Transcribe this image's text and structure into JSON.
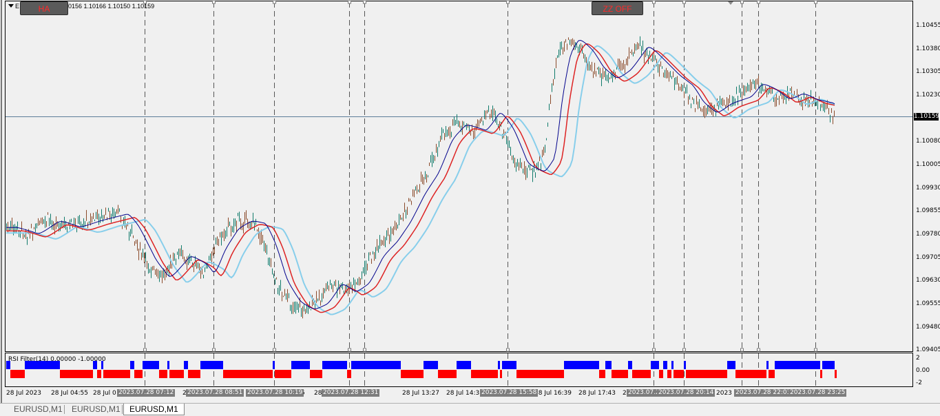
{
  "header": {
    "symbol_prefix": "E",
    "ohlc_partial": "0156 1.10166 1.10150 1.10159",
    "ha_button": "HA",
    "zz_button": "ZZ OFF"
  },
  "price_axis": {
    "labels": [
      "1.10455",
      "1.10380",
      "1.10305",
      "1.10230",
      "1.10080",
      "1.10005",
      "1.09930",
      "1.09855",
      "1.09780",
      "1.09705",
      "1.09630",
      "1.09555",
      "1.09480",
      "1.09405"
    ],
    "current_price": "1.10159"
  },
  "indicator": {
    "title": "RSI Filter(14) 0.00000 -1.00000",
    "levels": [
      "2",
      "0.00",
      "-2"
    ]
  },
  "time_axis": {
    "labels": [
      "28 Jul 2023",
      "28 Jul 04:55",
      "28 Jul 0",
      "2",
      "28",
      "5",
      "28 Jul 13:27",
      "28 Jul 14:31",
      "28 Jul 16:39",
      "28 Jul 17:43",
      "2",
      "2",
      "2023"
    ],
    "highlights": [
      "2023.07.28 07:12",
      "2023.07.28 08:51",
      "2023.07.28 10:19",
      "2023.07.28 12:31",
      "2023.07.28 15:58",
      "2023.07.2",
      "2023.07.28 20:14",
      "2023.07.28 22:03",
      "2023.07.28 23:25"
    ]
  },
  "tabs": [
    "EURUSD,M1",
    "EURUSD,M1",
    "EURUSD,M1"
  ],
  "colors": {
    "background": "#f0f0f0",
    "bull_candle": "#0f7a6a",
    "bear_candle": "#8a4a2a",
    "ma_fast": "#00008b",
    "ma_slow": "#87ceeb",
    "ma_red": "#dd2222",
    "rsi_up": "#0000ff",
    "rsi_down": "#ff0000"
  }
}
